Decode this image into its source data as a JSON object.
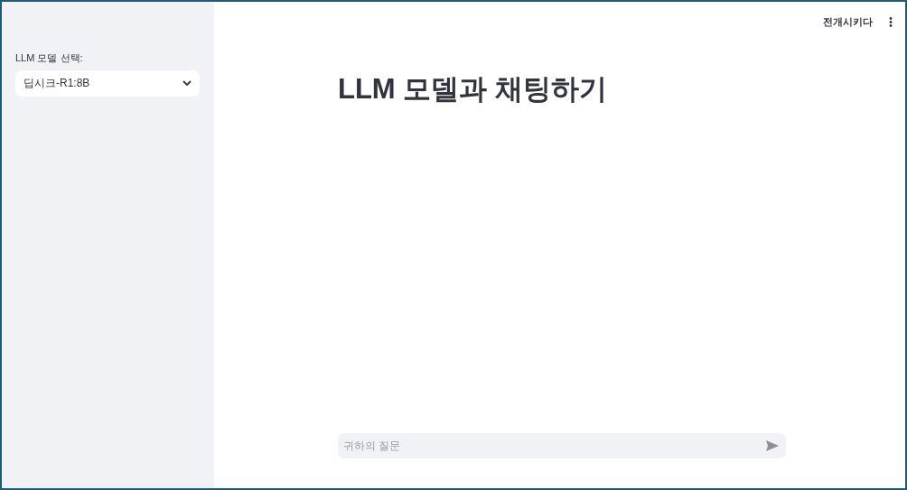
{
  "sidebar": {
    "model_select": {
      "label": "LLM 모델 선택:",
      "value": "딥시크-R1:8B"
    }
  },
  "header": {
    "deploy_button": "전개시키다"
  },
  "main": {
    "title": "LLM 모델과 채팅하기"
  },
  "chat_input": {
    "placeholder": "귀하의 질문"
  }
}
